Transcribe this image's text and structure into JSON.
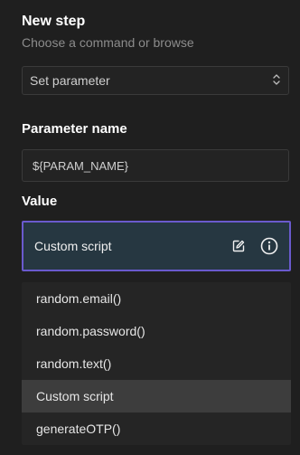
{
  "header": {
    "title": "New step",
    "subtitle": "Choose a command or browse"
  },
  "command_select": {
    "value": "Set parameter"
  },
  "parameter": {
    "label": "Parameter name",
    "value": "${PARAM_NAME}"
  },
  "value_section": {
    "label": "Value",
    "current": "Custom script"
  },
  "dropdown": {
    "options": [
      {
        "label": "random.email()"
      },
      {
        "label": "random.password()"
      },
      {
        "label": "random.text()"
      },
      {
        "label": "Custom script"
      },
      {
        "label": "generateOTP()"
      }
    ],
    "selected": "Custom script"
  },
  "colors": {
    "background": "#1f1f1f",
    "accent_border": "#6a5acd",
    "value_field_bg": "#263741",
    "selected_option_bg": "#3d3d3d"
  },
  "icons": {
    "select": "chevron-up-down-icon",
    "edit": "edit-icon",
    "info": "info-icon"
  }
}
